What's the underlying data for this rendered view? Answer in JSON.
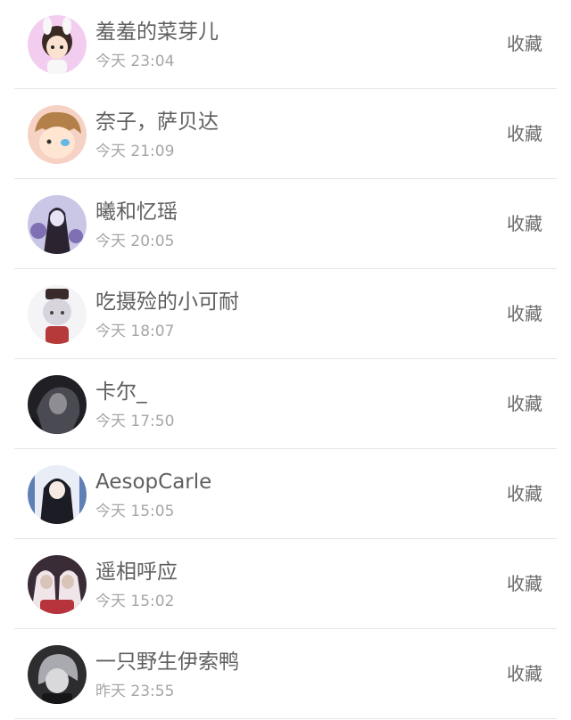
{
  "favorites": {
    "items": [
      {
        "name": "羞羞的菜芽儿",
        "time": "今天 23:04",
        "action": "收藏",
        "avatar_colors": [
          "#f3cdf0",
          "#3b2a24",
          "#fbe2d0",
          "#f7f7f7"
        ]
      },
      {
        "name": "奈子，萨贝达",
        "time": "今天 21:09",
        "action": "收藏",
        "avatar_colors": [
          "#f6d2c4",
          "#b28048",
          "#ffe6d3",
          "#64b7e6"
        ]
      },
      {
        "name": "曦和忆瑶",
        "time": "今天 20:05",
        "action": "收藏",
        "avatar_colors": [
          "#c9c6e6",
          "#2b2430",
          "#e7e3f4",
          "#7f6fb3"
        ]
      },
      {
        "name": "吃摄殓的小可耐",
        "time": "今天 18:07",
        "action": "收藏",
        "avatar_colors": [
          "#f4f4f6",
          "#3a2a2a",
          "#d7d4dd",
          "#b73a3a"
        ]
      },
      {
        "name": "卡尔_",
        "time": "今天 17:50",
        "action": "收藏",
        "avatar_colors": [
          "#1f1f24",
          "#4a4a52",
          "#8d8d93",
          "#121216"
        ]
      },
      {
        "name": "AesopCarle",
        "time": "今天 15:05",
        "action": "收藏",
        "avatar_colors": [
          "#e8edf6",
          "#1c1c24",
          "#f5e9e3",
          "#5f7fb5"
        ]
      },
      {
        "name": "遥相呼应",
        "time": "今天 15:02",
        "action": "收藏",
        "avatar_colors": [
          "#3a2c37",
          "#f0e6ea",
          "#b8343d",
          "#d9c4b8"
        ]
      },
      {
        "name": "一只野生伊索鸭",
        "time": "昨天 23:55",
        "action": "收藏",
        "avatar_colors": [
          "#2d2d30",
          "#a9aab0",
          "#d9d9dc",
          "#161618"
        ]
      }
    ]
  }
}
